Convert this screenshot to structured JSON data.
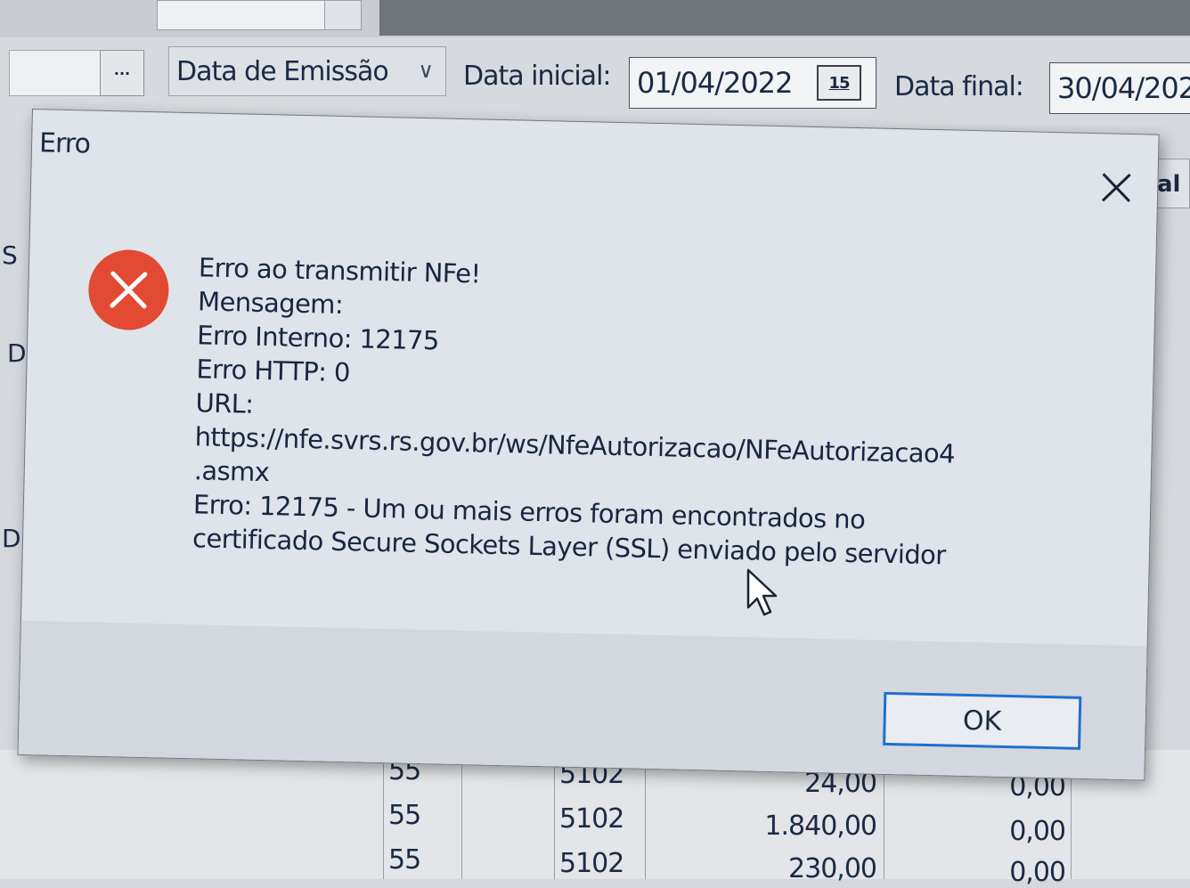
{
  "filter": {
    "ellipsis_label": "···",
    "date_type": "Data de Emissão",
    "start_label": "Data inicial:",
    "start_value": "01/04/2022",
    "calendar_icon_text": "15",
    "end_label": "Data final:",
    "end_value": "30/04/202"
  },
  "side_fragments": [
    "S",
    "D",
    "D"
  ],
  "right_fragment": "al I",
  "dialog": {
    "title": "Erro",
    "lines": [
      "Erro ao transmitir NFe!",
      "Mensagem:",
      "Erro Interno: 12175",
      "Erro HTTP: 0",
      "URL:",
      "https://nfe.svrs.rs.gov.br/ws/NfeAutorizacao/NFeAutorizacao4",
      ".asmx",
      "Erro: 12175 - Um ou mais erros foram encontrados no",
      "certificado Secure Sockets Layer (SSL) enviado pelo servidor"
    ],
    "ok_label": "OK",
    "icons": {
      "close": "close-icon",
      "error": "error-icon"
    },
    "colors": {
      "error_red": "#e24a33",
      "ok_border": "#1e6fd0"
    }
  },
  "table": {
    "rows": [
      {
        "mod": "55",
        "cfop": "5102",
        "value": "24,00",
        "other": "0,00"
      },
      {
        "mod": "55",
        "cfop": "5102",
        "value": "1.840,00",
        "other": "0,00"
      },
      {
        "mod": "55",
        "cfop": "5102",
        "value": "230,00",
        "other": "0,00"
      }
    ]
  }
}
